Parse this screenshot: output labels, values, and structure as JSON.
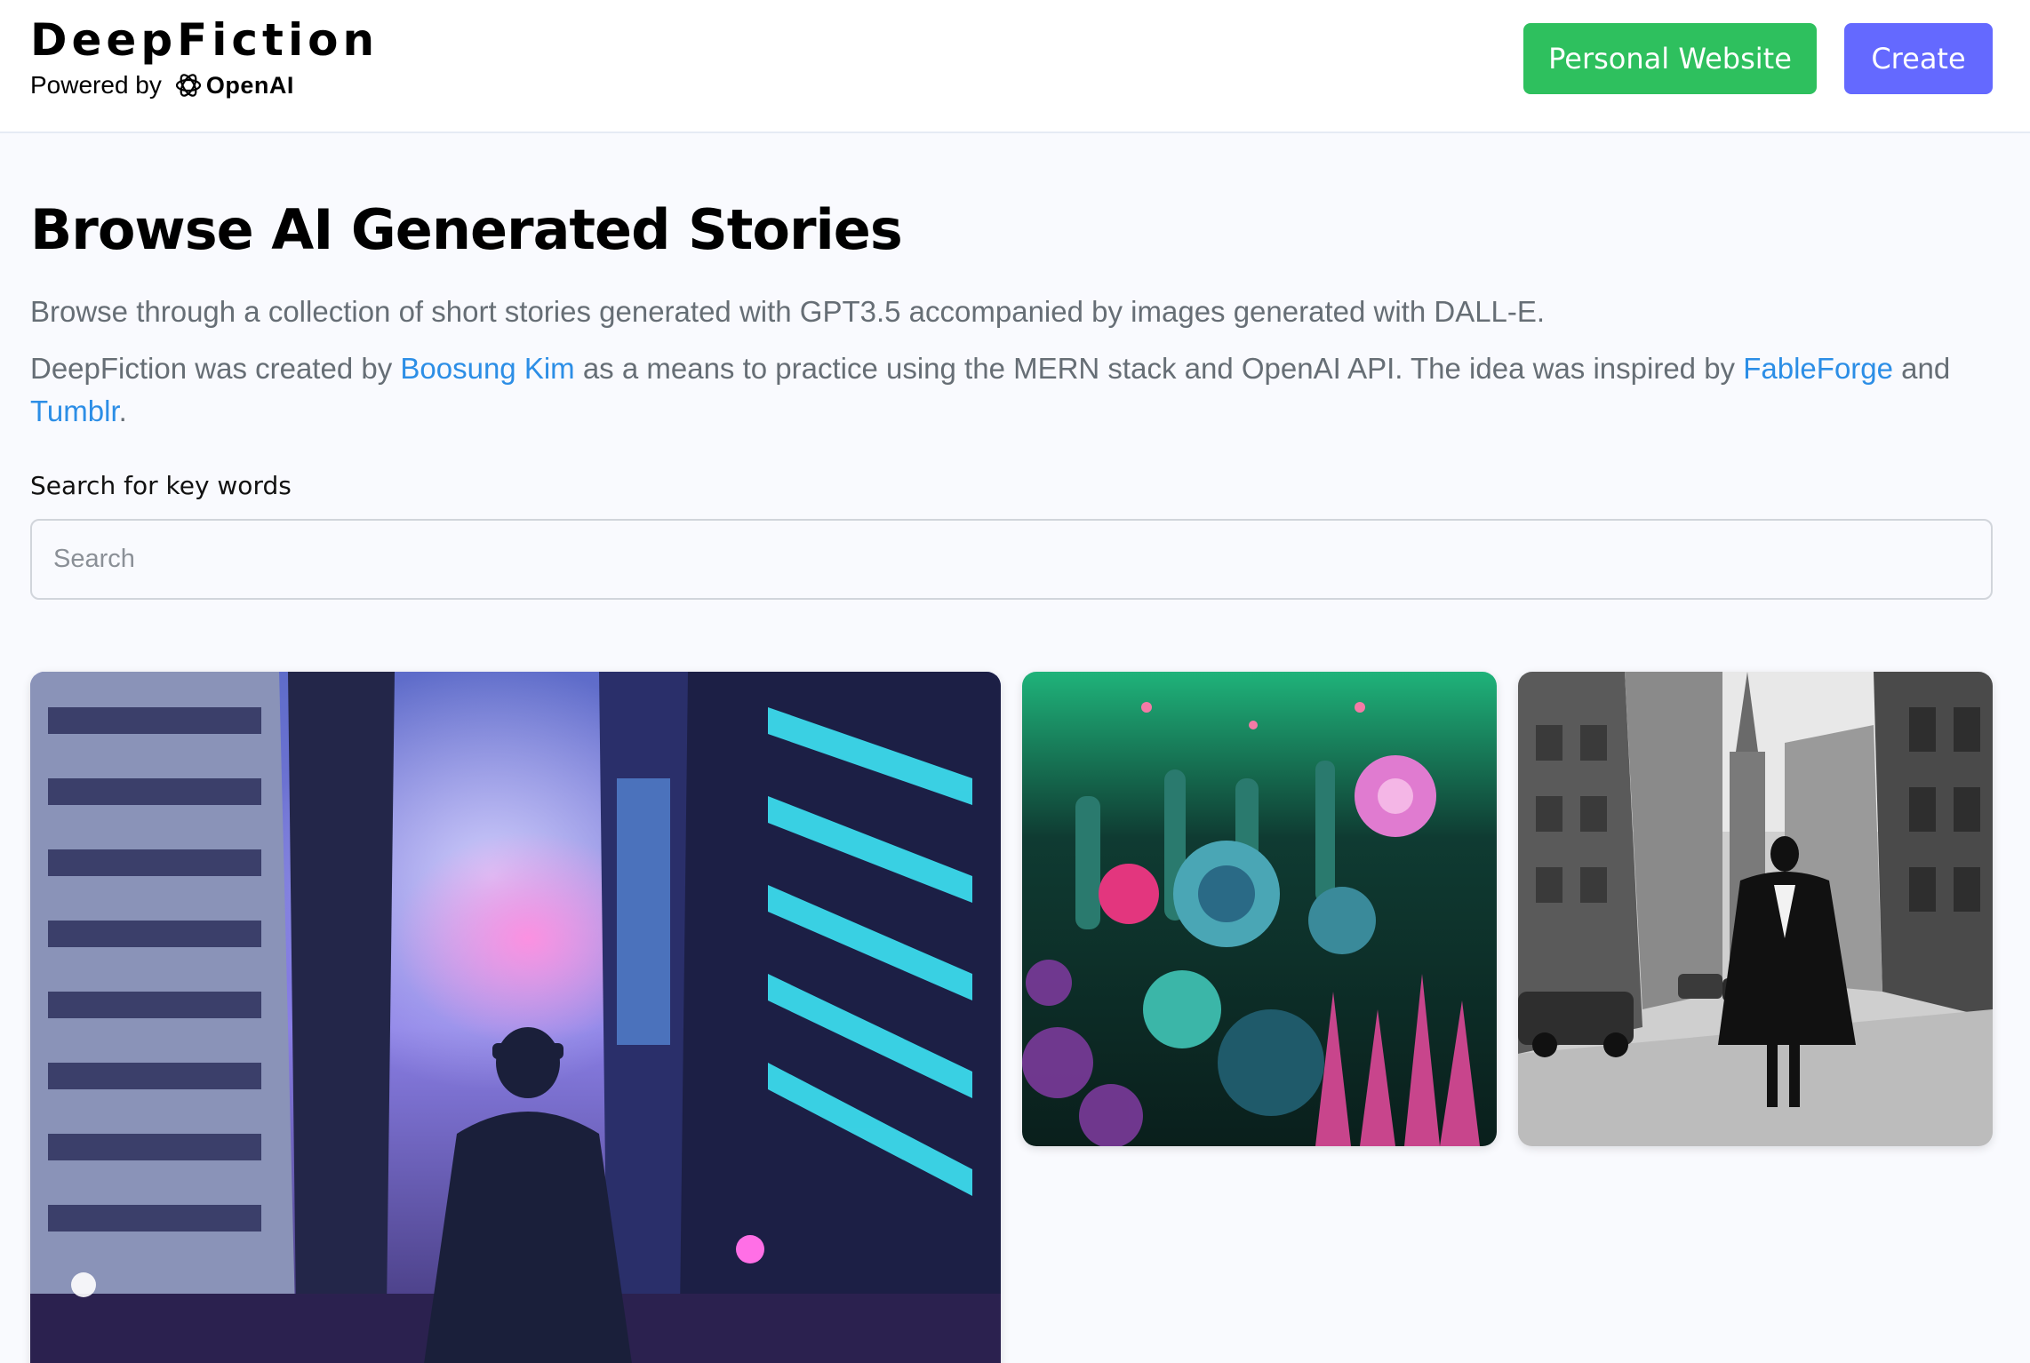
{
  "header": {
    "brand": "DeepFiction",
    "powered_by": "Powered by",
    "provider": "OpenAI",
    "personal_website_label": "Personal Website",
    "create_label": "Create",
    "colors": {
      "personal_button": "#2ec05e",
      "create_button": "#6469ff"
    }
  },
  "main": {
    "title": "Browse AI Generated Stories",
    "description_1": "Browse through a collection of short stories generated with GPT3.5 accompanied by images generated with DALL-E.",
    "description_2": {
      "part1": "DeepFiction was created by ",
      "link_author": "Boosung Kim",
      "part2": " as a means to practice using the MERN stack and OpenAI API. The idea was inspired by ",
      "link_fableforge": "FableForge",
      "part3": " and ",
      "link_tumblr": "Tumblr",
      "part4": "."
    },
    "link_color": "#2c8ee6",
    "search": {
      "label": "Search for key words",
      "placeholder": "Search",
      "value": ""
    }
  },
  "gallery": [
    {
      "name": "cyberpunk-city-card",
      "subject": "figure in neon-lit futuristic city"
    },
    {
      "name": "coral-reef-card",
      "subject": "colorful underwater coral reef"
    },
    {
      "name": "vintage-street-card",
      "subject": "black and white street with caped figure"
    }
  ],
  "icons": {
    "openai": "openai-logo-icon"
  }
}
